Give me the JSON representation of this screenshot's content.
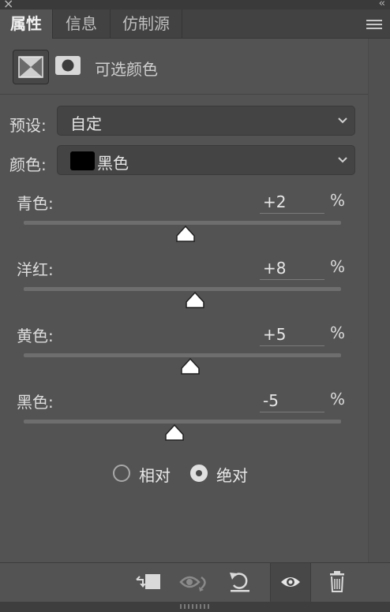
{
  "window": {
    "close_glyph": "×",
    "collapse_glyph": "‹‹"
  },
  "tabs": [
    {
      "label": "属性",
      "active": true
    },
    {
      "label": "信息",
      "active": false
    },
    {
      "label": "仿制源",
      "active": false
    }
  ],
  "header": {
    "title": "可选颜色",
    "adjustment_icon": "selective-color-icon",
    "mask_icon": "layer-mask-icon"
  },
  "preset": {
    "label": "预设:",
    "value": "自定"
  },
  "color": {
    "label": "颜色:",
    "value": "黑色",
    "swatch_color": "#000000"
  },
  "sliders": [
    {
      "label": "青色:",
      "value": "+2",
      "unit": "%",
      "level": 2
    },
    {
      "label": "洋红:",
      "value": "+8",
      "unit": "%",
      "level": 8
    },
    {
      "label": "黄色:",
      "value": "+5",
      "unit": "%",
      "level": 5
    },
    {
      "label": "黑色:",
      "value": "-5",
      "unit": "%",
      "level": -5
    }
  ],
  "method": {
    "relative_label": "相对",
    "absolute_label": "绝对",
    "selected": "absolute"
  },
  "bottom_toolbar": [
    {
      "name": "clip-to-layer-icon"
    },
    {
      "name": "view-previous-state-icon"
    },
    {
      "name": "reset-icon"
    },
    {
      "name": "visibility-eye-icon"
    },
    {
      "name": "trash-icon"
    }
  ],
  "colors": {
    "panel_bg": "#535353",
    "tab_bar_bg": "#424242",
    "field_bg": "#444444"
  }
}
